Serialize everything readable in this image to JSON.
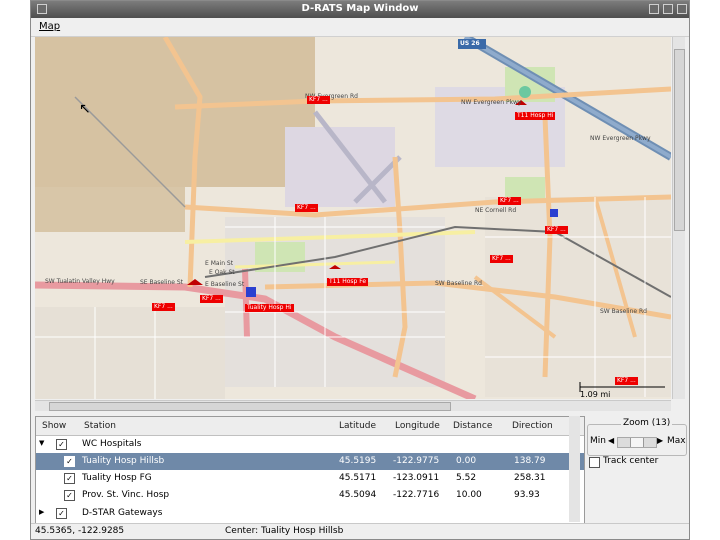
{
  "window": {
    "title": "D-RATS Map Window"
  },
  "menu": {
    "map_label": "Map"
  },
  "map": {
    "highway_shield": "US 26",
    "scale_label": "1.09 mi",
    "road_labels": [
      "NW Evergreen Pkwy",
      "NW Evergreen Pkwy",
      "NW Evergreen Rd",
      "SW Baseline Rd",
      "SW Baseline Rd",
      "SW Tualatin Valley Hwy",
      "E Main St",
      "SE Baseline St",
      "E Oak St",
      "NE Cornell Rd",
      "E Baseline St"
    ],
    "station_tags": [
      "KF7 ...",
      "T11 Hosp Hi",
      "KF7 ...",
      "KF7 ...",
      "KF7 ...",
      "KF7 ...",
      "T11 Hosp Fe",
      "KF7 ...",
      "Tuality Hosp Hi",
      "KF7 ...",
      "KF7 ..."
    ]
  },
  "station_list": {
    "columns": [
      "Show",
      "Station",
      "Latitude",
      "Longitude",
      "Distance",
      "Direction"
    ],
    "groups": [
      {
        "name": "WC Hospitals",
        "expanded": true,
        "show": true
      },
      {
        "name": "D-STAR Gateways",
        "expanded": false,
        "show": true
      }
    ],
    "rows": [
      {
        "show": true,
        "station": "Tuality Hosp Hillsb",
        "latitude": "45.5195",
        "longitude": "-122.9775",
        "distance": "0.00",
        "direction": "138.79",
        "selected": true
      },
      {
        "show": true,
        "station": "Tuality Hosp FG",
        "latitude": "45.5171",
        "longitude": "-123.0911",
        "distance": "5.52",
        "direction": "258.31",
        "selected": false
      },
      {
        "show": true,
        "station": "Prov. St. Vinc. Hosp",
        "latitude": "45.5094",
        "longitude": "-122.7716",
        "distance": "10.00",
        "direction": "93.93",
        "selected": false
      }
    ]
  },
  "zoom": {
    "label": "Zoom (13)",
    "min_label": "Min",
    "max_label": "Max",
    "level": 13
  },
  "track_center": {
    "label": "Track center",
    "checked": false
  },
  "status": {
    "coords": "45.5365, -122.9285",
    "center": "Center: Tuality Hosp Hillsb"
  }
}
